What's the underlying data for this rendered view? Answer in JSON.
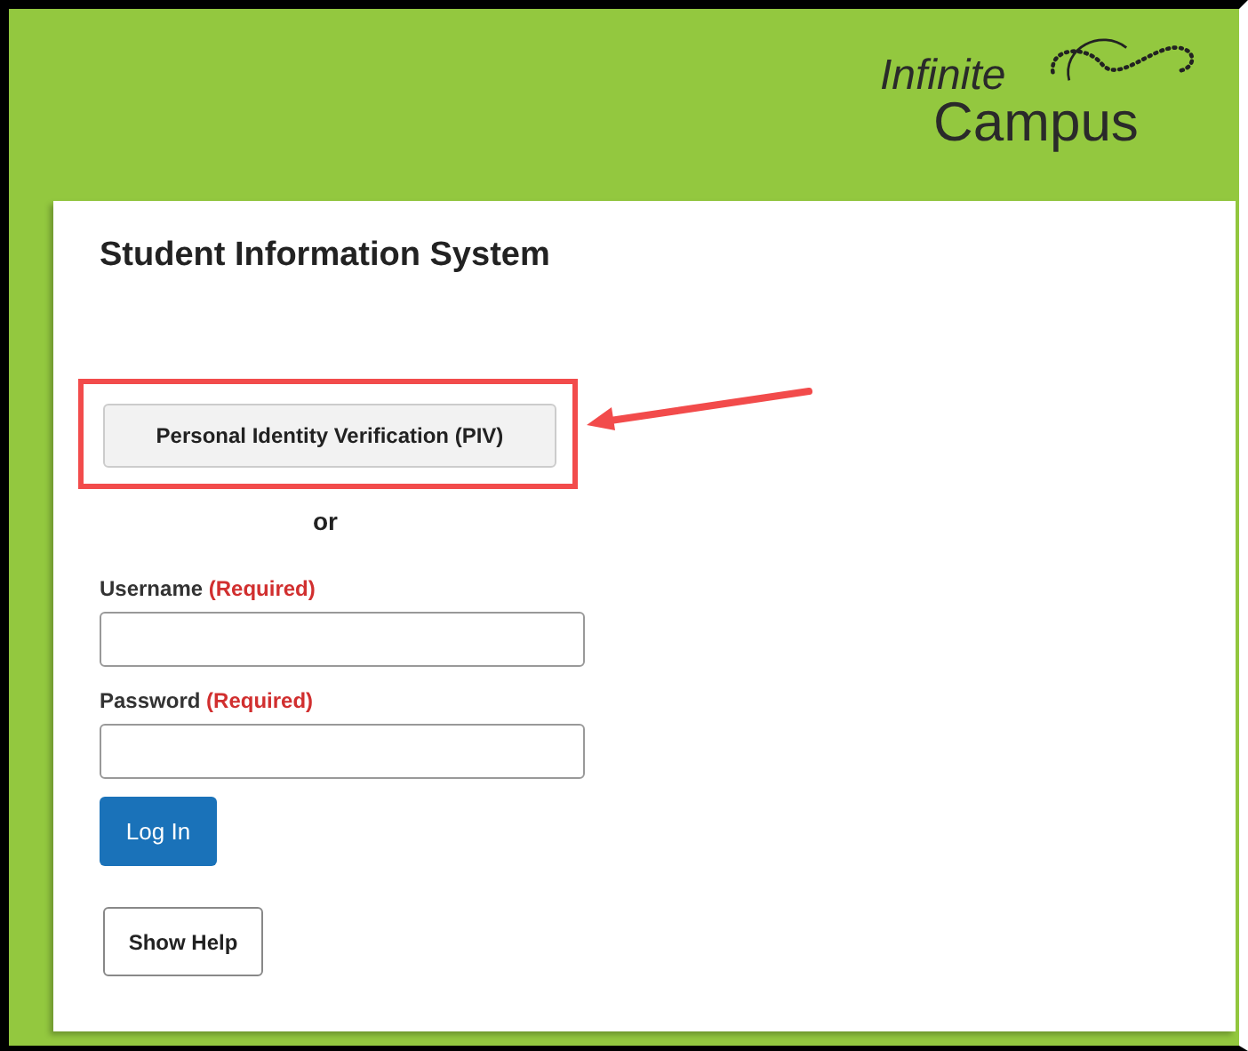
{
  "logo": {
    "line_1": "Infinite",
    "line_2": "Campus"
  },
  "title": "Student Information System",
  "piv_button": {
    "label": "Personal Identity Verification (PIV)",
    "highlighted": true
  },
  "separator": "or",
  "fields": [
    {
      "label": "Username",
      "note": "(Required)"
    },
    {
      "label": "Password",
      "note": "(Required)"
    }
  ],
  "login_button": "Log In",
  "help_button": "Show Help"
}
